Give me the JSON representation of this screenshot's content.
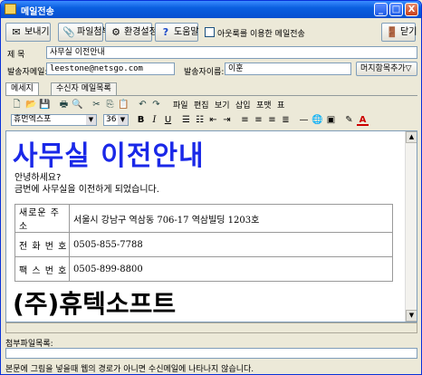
{
  "window": {
    "title": "메일전송",
    "minimize": "_",
    "maximize": "□",
    "close": "X"
  },
  "toolbar": {
    "send": "보내기",
    "attach": "파일첨부",
    "settings": "환경설정",
    "help": "도움말",
    "outlook_label": "아웃룩를 이용한 메일전송",
    "close": "닫기"
  },
  "icons": {
    "send": "✉",
    "attach": "📎",
    "settings": "⚙",
    "help": "?",
    "close": "🚪"
  },
  "form": {
    "subject_label": "제    목",
    "subject_value": "사무실 이전안내",
    "sender_email_label": "발송자메일:",
    "sender_email_value": "leestone@netsgo.com",
    "sender_name_label": "발송자이름:",
    "sender_name_value": "이훈",
    "signature_button": "머지항목추가▽"
  },
  "tabs": [
    {
      "label": "메세지"
    },
    {
      "label": "수신자 메일목록"
    }
  ],
  "editor_menu": [
    "파일",
    "편집",
    "보기",
    "삽입",
    "포맷",
    "표"
  ],
  "format": {
    "font": "휴먼엑스포",
    "size": "36",
    "bold": "B",
    "italic": "I",
    "underline": "U"
  },
  "content": {
    "title": "사무실 이전안내",
    "greeting": "안녕하세요?",
    "body": "금번에 사무실을 이전하게 되었습니다.",
    "company": "(주)휴텍소프트",
    "table": [
      {
        "key": "새로운 주소",
        "value": "서울시 강남구 역삼동 706-17 역삼빌딩 1203호"
      },
      {
        "key": "전 화 번 호",
        "value": "0505-855-7788"
      },
      {
        "key": "팩 스 번 호",
        "value": "0505-899-8800"
      }
    ]
  },
  "attachments": {
    "label": "첨부파일목록:"
  },
  "footer": "본문에 그림을 넣을때 웹의 경로가 아니면 수신메일에 나타나지 않습니다."
}
